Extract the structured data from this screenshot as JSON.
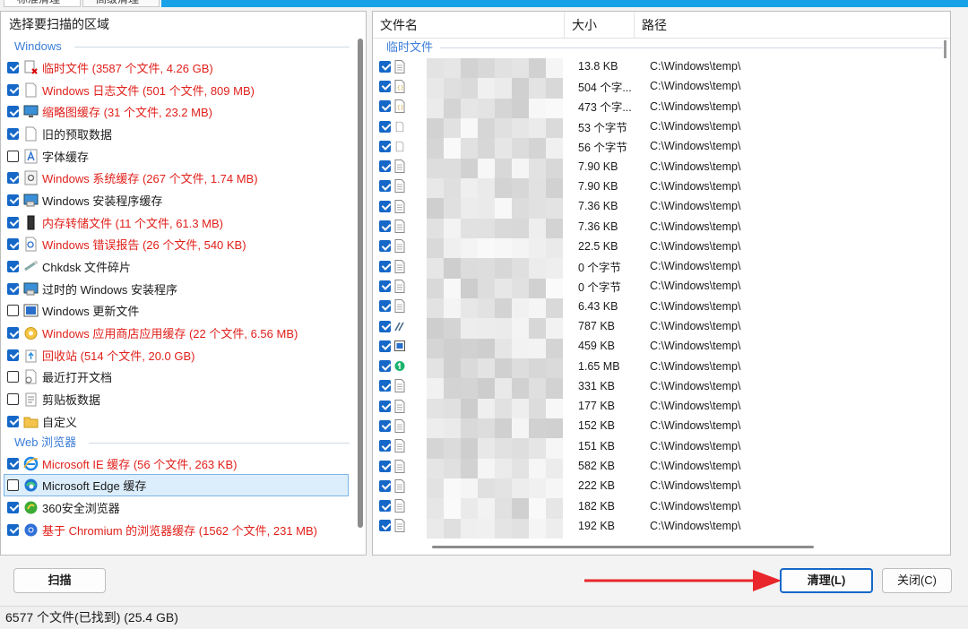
{
  "tabs": [
    {
      "label": "标准清理"
    },
    {
      "label": "高级清理"
    }
  ],
  "left": {
    "header": "选择要扫描的区域",
    "groups": [
      {
        "name": "Windows",
        "items": [
          {
            "label": "临时文件 (3587 个文件, 4.26 GB)",
            "checked": true,
            "red": true,
            "icon": "temp-files-icon"
          },
          {
            "label": "Windows 日志文件 (501 个文件, 809 MB)",
            "checked": true,
            "red": true,
            "icon": "log-file-icon"
          },
          {
            "label": "缩略图缓存 (31 个文件, 23.2 MB)",
            "checked": true,
            "red": true,
            "icon": "monitor-icon"
          },
          {
            "label": "旧的预取数据",
            "checked": true,
            "red": false,
            "icon": "blank-file-icon"
          },
          {
            "label": "字体缓存",
            "checked": false,
            "red": false,
            "icon": "font-icon"
          },
          {
            "label": "Windows 系统缓存 (267 个文件, 1.74 MB)",
            "checked": true,
            "red": true,
            "icon": "system-cache-icon"
          },
          {
            "label": "Windows 安装程序缓存",
            "checked": true,
            "red": false,
            "icon": "installer-icon"
          },
          {
            "label": "内存转储文件 (11 个文件, 61.3 MB)",
            "checked": true,
            "red": true,
            "icon": "memory-dump-icon"
          },
          {
            "label": "Windows 错误报告 (26 个文件, 540 KB)",
            "checked": true,
            "red": true,
            "icon": "error-report-icon"
          },
          {
            "label": "Chkdsk 文件碎片",
            "checked": true,
            "red": false,
            "icon": "chkdsk-icon"
          },
          {
            "label": "过时的 Windows 安装程序",
            "checked": true,
            "red": false,
            "icon": "installer-icon"
          },
          {
            "label": "Windows 更新文件",
            "checked": false,
            "red": false,
            "icon": "windows-update-icon"
          },
          {
            "label": "Windows 应用商店应用缓存 (22 个文件, 6.56 MB)",
            "checked": true,
            "red": true,
            "icon": "store-icon"
          },
          {
            "label": "回收站 (514 个文件, 20.0 GB)",
            "checked": true,
            "red": true,
            "icon": "recycle-bin-icon"
          },
          {
            "label": "最近打开文档",
            "checked": false,
            "red": false,
            "icon": "recent-docs-icon"
          },
          {
            "label": "剪贴板数据",
            "checked": false,
            "red": false,
            "icon": "clipboard-icon"
          },
          {
            "label": "自定义",
            "checked": true,
            "red": false,
            "icon": "folder-icon"
          }
        ]
      },
      {
        "name": "Web 浏览器",
        "items": [
          {
            "label": "Microsoft IE 缓存 (56 个文件, 263 KB)",
            "checked": true,
            "red": true,
            "icon": "ie-icon"
          },
          {
            "label": "Microsoft Edge 缓存",
            "checked": false,
            "red": false,
            "icon": "edge-icon",
            "selected": true
          },
          {
            "label": "360安全浏览器",
            "checked": true,
            "red": false,
            "icon": "browser-360-icon"
          },
          {
            "label": "基于 Chromium 的浏览器缓存 (1562 个文件, 231 MB)",
            "checked": true,
            "red": true,
            "icon": "chromium-icon"
          }
        ]
      }
    ]
  },
  "right": {
    "columns": {
      "name": "文件名",
      "size": "大小",
      "path": "路径"
    },
    "group": "临时文件",
    "files": [
      {
        "size": "13.8 KB",
        "path": "C:\\Windows\\temp\\",
        "icon": "file-icon"
      },
      {
        "size": "504 个字...",
        "path": "C:\\Windows\\temp\\",
        "icon": "json-file-icon"
      },
      {
        "size": "473 个字...",
        "path": "C:\\Windows\\temp\\",
        "icon": "json-file-icon"
      },
      {
        "size": "53 个字节",
        "path": "C:\\Windows\\temp\\",
        "icon": "blank-file-icon"
      },
      {
        "size": "56 个字节",
        "path": "C:\\Windows\\temp\\",
        "icon": "blank-file-icon"
      },
      {
        "size": "7.90 KB",
        "path": "C:\\Windows\\temp\\",
        "icon": "file-icon"
      },
      {
        "size": "7.90 KB",
        "path": "C:\\Windows\\temp\\",
        "icon": "file-icon"
      },
      {
        "size": "7.36 KB",
        "path": "C:\\Windows\\temp\\",
        "icon": "file-icon"
      },
      {
        "size": "7.36 KB",
        "path": "C:\\Windows\\temp\\",
        "icon": "file-icon"
      },
      {
        "size": "22.5 KB",
        "path": "C:\\Windows\\temp\\",
        "icon": "file-icon"
      },
      {
        "size": "0 个字节",
        "path": "C:\\Windows\\temp\\",
        "icon": "file-icon"
      },
      {
        "size": "0 个字节",
        "path": "C:\\Windows\\temp\\",
        "icon": "file-icon"
      },
      {
        "size": "6.43 KB",
        "path": "C:\\Windows\\temp\\",
        "icon": "file-icon"
      },
      {
        "size": "787 KB",
        "path": "C:\\Windows\\temp\\",
        "icon": "vscode-file-icon"
      },
      {
        "size": "459 KB",
        "path": "C:\\Windows\\temp\\",
        "icon": "window-file-icon"
      },
      {
        "size": "1.65 MB",
        "path": "C:\\Windows\\temp\\",
        "icon": "green-app-icon"
      },
      {
        "size": "331 KB",
        "path": "C:\\Windows\\temp\\",
        "icon": "file-icon"
      },
      {
        "size": "177 KB",
        "path": "C:\\Windows\\temp\\",
        "icon": "file-icon"
      },
      {
        "size": "152 KB",
        "path": "C:\\Windows\\temp\\",
        "icon": "file-icon"
      },
      {
        "size": "151 KB",
        "path": "C:\\Windows\\temp\\",
        "icon": "file-icon"
      },
      {
        "size": "582 KB",
        "path": "C:\\Windows\\temp\\",
        "icon": "file-icon"
      },
      {
        "size": "222 KB",
        "path": "C:\\Windows\\temp\\",
        "icon": "file-icon"
      },
      {
        "size": "182 KB",
        "path": "C:\\Windows\\temp\\",
        "icon": "file-icon"
      },
      {
        "size": "192 KB",
        "path": "C:\\Windows\\temp\\",
        "icon": "file-icon"
      }
    ]
  },
  "buttons": {
    "scan": "扫描",
    "clean": "清理(L)",
    "close": "关闭(C)"
  },
  "status": "6577  个文件(已找到) (25.4 GB)",
  "colors": {
    "accent": "#17a2e8",
    "danger": "#e0201b",
    "group": "#3b7dd8",
    "check": "#1668c8",
    "arrow": "#e8262b"
  }
}
